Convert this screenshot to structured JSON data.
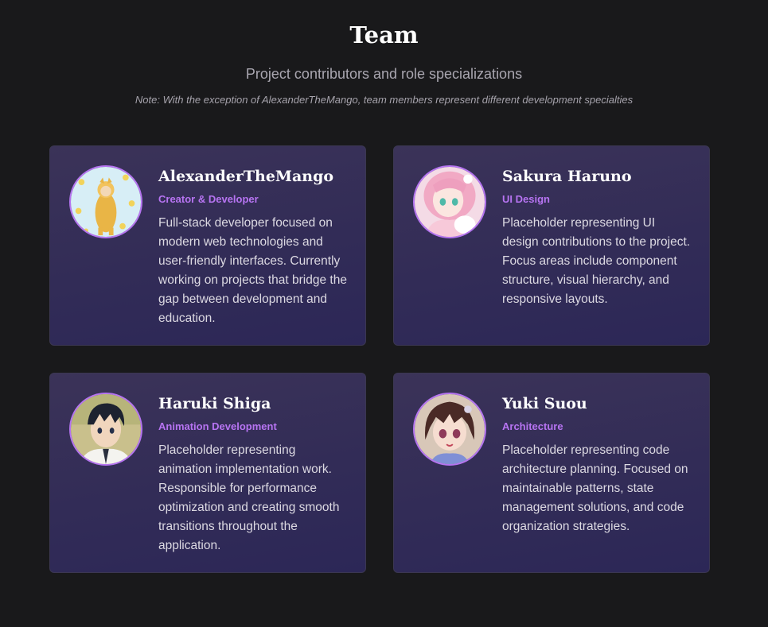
{
  "header": {
    "title": "Team",
    "subtitle": "Project contributors and role specializations",
    "note": "Note: With the exception of AlexanderTheMango, team members represent different development specialties"
  },
  "colors": {
    "background": "#19191b",
    "card": "#352f58",
    "accent": "#b774f2",
    "text": "#dcd9e2"
  },
  "members": [
    {
      "name": "AlexanderTheMango",
      "role": "Creator & Developer",
      "bio": "Full-stack developer focused on modern web technologies and user-friendly interfaces. Currently working on projects that bridge the gap between development and education.",
      "avatar_icon": "mango-costume-avatar"
    },
    {
      "name": "Sakura Haruno",
      "role": "UI Design",
      "bio": "Placeholder representing UI design contributions to the project. Focus areas include component structure, visual hierarchy, and responsive layouts.",
      "avatar_icon": "pink-hair-anime-avatar"
    },
    {
      "name": "Haruki Shiga",
      "role": "Animation Development",
      "bio": "Placeholder representing animation implementation work. Responsible for performance optimization and creating smooth transitions throughout the application.",
      "avatar_icon": "dark-hair-anime-avatar"
    },
    {
      "name": "Yuki Suou",
      "role": "Architecture",
      "bio": "Placeholder representing code architecture planning. Focused on maintainable patterns, state management solutions, and code organization strategies.",
      "avatar_icon": "brown-hair-anime-avatar"
    }
  ]
}
